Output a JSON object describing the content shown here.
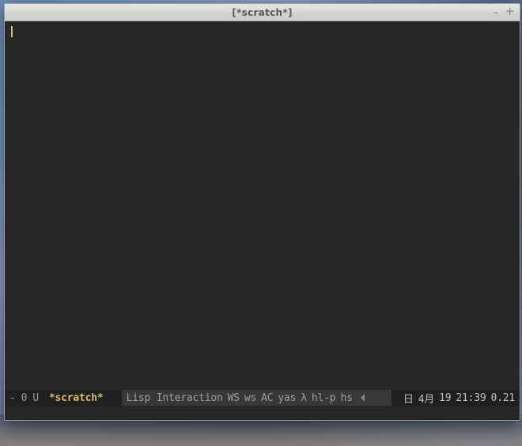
{
  "window": {
    "title": "[*scratch*]"
  },
  "modeline": {
    "modified_flag": "-",
    "line_no": "0",
    "encoding_flag": "U",
    "buffer_name": "*scratch*",
    "major_mode": "Lisp Interaction",
    "minor_modes": [
      "WS",
      "ws",
      "AC",
      "yas",
      "λ",
      "hl-p",
      "hs"
    ],
    "weekday": "日",
    "month_label": "4月",
    "day": "19",
    "time": "21:39",
    "load": "0.21"
  }
}
